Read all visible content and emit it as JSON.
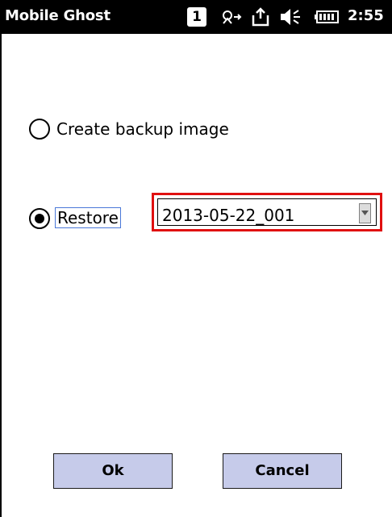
{
  "titlebar": {
    "app_title": "Mobile Ghost",
    "notification_count": "1",
    "time": "2:55",
    "icons": [
      "notification-icon",
      "connectivity-icon",
      "sync-icon",
      "speaker-icon",
      "battery-icon"
    ]
  },
  "options": {
    "backup_label": "Create backup image",
    "backup_selected": false,
    "restore_label": "Restore",
    "restore_selected": true
  },
  "restore_select": {
    "value": "2013-05-22_001",
    "highlight_color": "#e01010"
  },
  "buttons": {
    "ok_label": "Ok",
    "cancel_label": "Cancel",
    "color": "#c6cbea"
  }
}
